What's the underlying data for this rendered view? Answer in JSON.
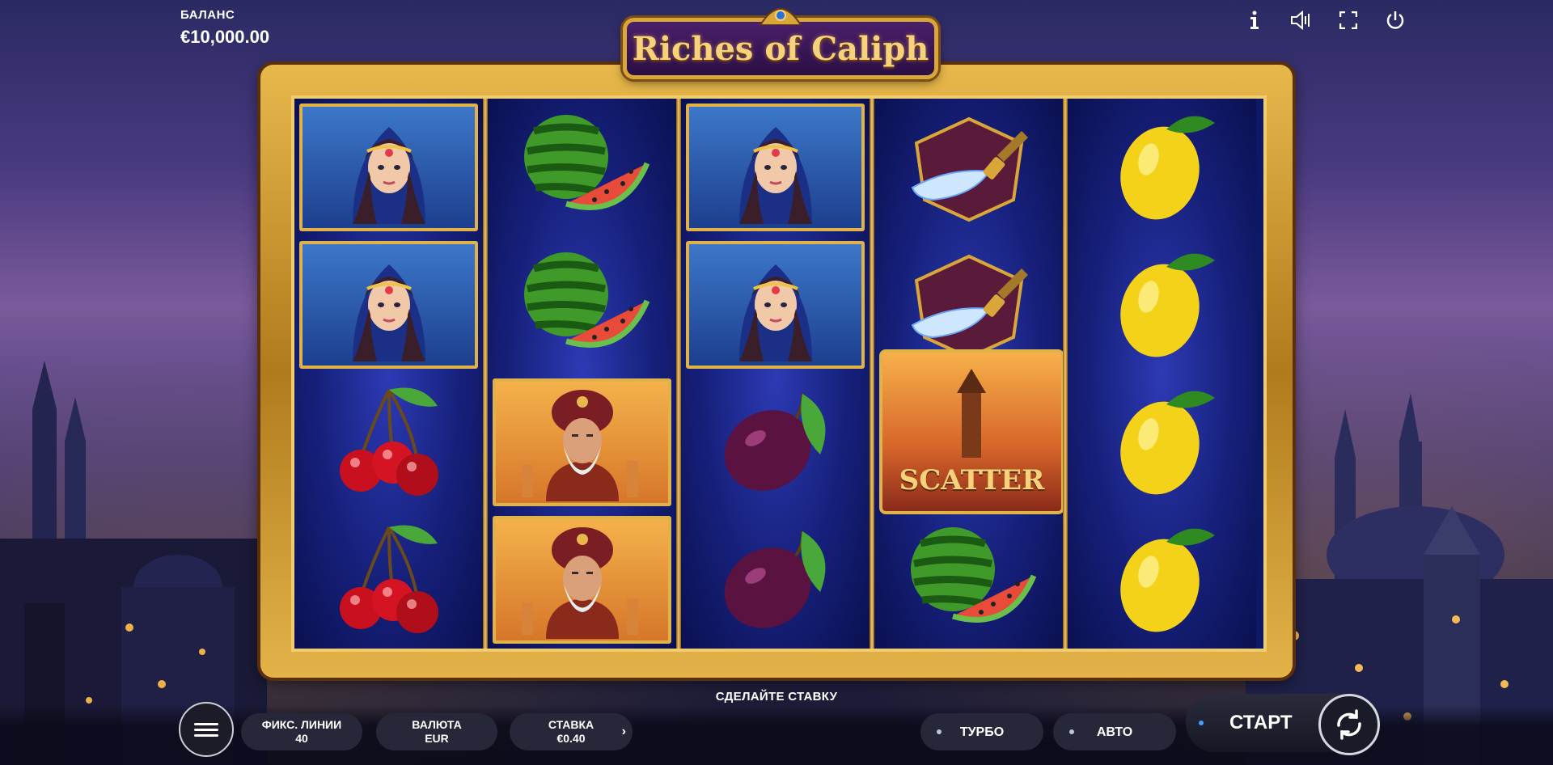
{
  "balance": {
    "label": "БАЛАНС",
    "value": "€10,000.00"
  },
  "title": "Riches of Caliph",
  "top_icons": [
    "info-icon",
    "sound-icon",
    "fullscreen-icon",
    "power-icon"
  ],
  "reels": [
    [
      "princess",
      "princess",
      "cherries",
      "cherries"
    ],
    [
      "watermelon",
      "watermelon",
      "caliph",
      "caliph"
    ],
    [
      "princess",
      "princess",
      "plum",
      "plum"
    ],
    [
      "dagger",
      "dagger",
      "scatter",
      "watermelon"
    ],
    [
      "lemon",
      "lemon",
      "lemon",
      "lemon"
    ]
  ],
  "scatter_label": "SCATTER",
  "status_text": "СДЕЛАЙТЕ СТАВКУ",
  "controls": {
    "lines_label": "ФИКС. ЛИНИИ",
    "lines_value": "40",
    "currency_label": "ВАЛЮТА",
    "currency_value": "EUR",
    "bet_label": "СТАВКА",
    "bet_value": "€0.40",
    "turbo_label": "ТУРБО",
    "auto_label": "АВТО",
    "start_label": "СТАРТ"
  },
  "colors": {
    "frame_gold": "#d9a63a",
    "reel_blue": "#16207a",
    "title_text": "#f7d27a"
  }
}
